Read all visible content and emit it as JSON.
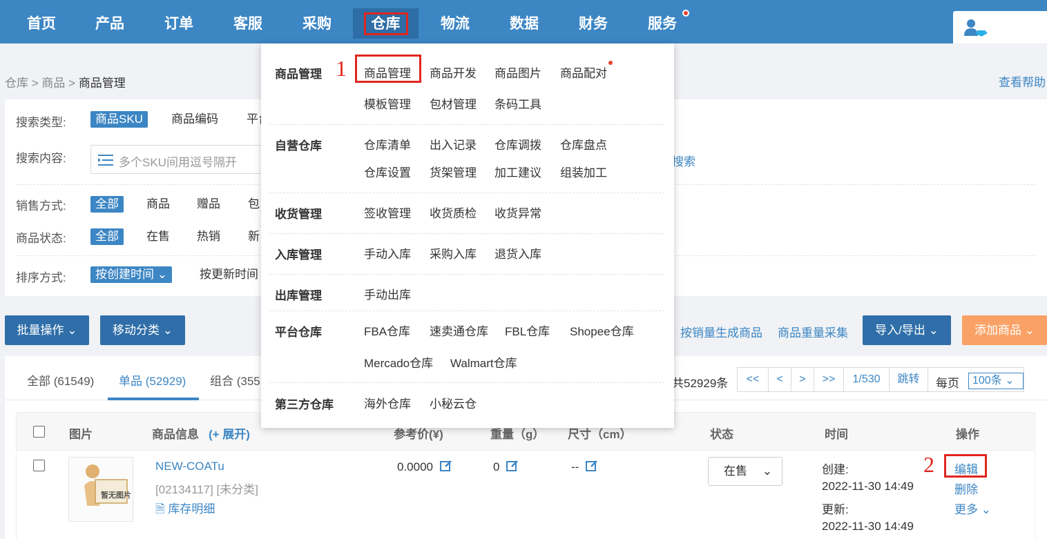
{
  "nav": {
    "items": [
      {
        "label": "首页"
      },
      {
        "label": "产品"
      },
      {
        "label": "订单"
      },
      {
        "label": "客服"
      },
      {
        "label": "采购"
      },
      {
        "label": "仓库"
      },
      {
        "label": "物流"
      },
      {
        "label": "数据"
      },
      {
        "label": "财务"
      },
      {
        "label": "服务"
      }
    ]
  },
  "breadcrumb": {
    "p1": "仓库",
    "sep": ">",
    "p2": "商品",
    "current": "商品管理"
  },
  "help_label": "查看帮助",
  "filter": {
    "search_type_label": "搜索类型:",
    "search_types": [
      "商品SKU",
      "商品编码",
      "平台"
    ],
    "search_content_label": "搜索内容:",
    "search_placeholder": "多个SKU间用逗号隔开",
    "search_link": "搜索",
    "sale_mode_label": "销售方式:",
    "sale_modes": [
      "全部",
      "商品",
      "赠品",
      "包"
    ],
    "status_label": "商品状态:",
    "statuses": [
      "全部",
      "在售",
      "热销",
      "新"
    ],
    "sort_label": "排序方式:",
    "sorts": [
      "按创建时间",
      "按更新时间"
    ]
  },
  "toolbar": {
    "batch": "批量操作",
    "move": "移动分类",
    "gen_by_sales": "按销量生成商品",
    "weight_collect": "商品重量采集",
    "import_export": "导入/导出",
    "add_product": "添加商品"
  },
  "tabs": [
    {
      "label": "全部 (61549)"
    },
    {
      "label": "单品 (52929)"
    },
    {
      "label": "组合 (355"
    }
  ],
  "pager": {
    "total": "共52929条",
    "first": "<<",
    "prev": "<",
    "next": ">",
    "last": ">>",
    "page": "1/530",
    "jump": "跳转",
    "per_page_label": "每页",
    "per_page": "100条"
  },
  "table": {
    "headers": {
      "image": "图片",
      "info": "商品信息",
      "expand": "(+ 展开)",
      "price": "参考价(¥)",
      "weight": "重量（g）",
      "size": "尺寸（cm）",
      "status": "状态",
      "time": "时间",
      "ops": "操作"
    },
    "rows": [
      {
        "thumb_text": "暂无图片",
        "name": "NEW-COATu",
        "code": "[02134117] [未分类]",
        "stock_link": "库存明细",
        "price": "0.0000",
        "weight": "0",
        "size": "--",
        "status": "在售",
        "created_label": "创建:",
        "created": "2022-11-30 14:49",
        "updated_label": "更新:",
        "updated": "2022-11-30 14:49",
        "op_edit": "编辑",
        "op_delete": "删除",
        "op_more": "更多"
      }
    ]
  },
  "dropdown": {
    "groups": [
      {
        "title": "商品管理",
        "items": [
          "商品管理",
          "商品开发",
          "商品图片",
          "商品配对",
          "模板管理",
          "包材管理",
          "条码工具"
        ]
      },
      {
        "title": "自营仓库",
        "items": [
          "仓库清单",
          "出入记录",
          "仓库调拨",
          "仓库盘点",
          "仓库设置",
          "货架管理",
          "加工建议",
          "组装加工"
        ]
      },
      {
        "title": "收货管理",
        "items": [
          "签收管理",
          "收货质检",
          "收货异常"
        ]
      },
      {
        "title": "入库管理",
        "items": [
          "手动入库",
          "采购入库",
          "退货入库"
        ]
      },
      {
        "title": "出库管理",
        "items": [
          "手动出库"
        ]
      },
      {
        "title": "平台仓库",
        "items": [
          "FBA仓库",
          "速卖通仓库",
          "FBL仓库",
          "Shopee仓库",
          "Mercado仓库",
          "Walmart仓库"
        ]
      },
      {
        "title": "第三方仓库",
        "items": [
          "海外仓库",
          "小秘云仓"
        ]
      }
    ]
  },
  "annotations": {
    "step1": "1",
    "step2": "2"
  },
  "colors": {
    "primary": "#3c86c4",
    "nav_bg": "#3c86c4",
    "orange": "#f9a166",
    "annotation_red": "#e0261f"
  }
}
